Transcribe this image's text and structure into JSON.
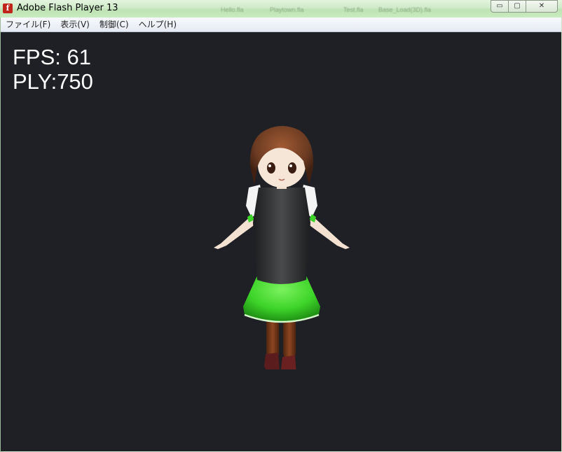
{
  "window": {
    "title": "Adobe Flash Player 13",
    "icon": "flash-icon",
    "icon_glyph": "f",
    "controls": {
      "minimize": "▭",
      "maximize": "▢",
      "close": "✕"
    },
    "background_tabs": [
      "Hello.fla",
      "Playtown.fla",
      "Test.fla",
      "Base_Load(3D).fla"
    ]
  },
  "menu": {
    "items": [
      "ファイル(F)",
      "表示(V)",
      "制御(C)",
      "ヘルプ(H)"
    ]
  },
  "stage": {
    "background_color": "#1e2025",
    "stats": {
      "fps": "FPS: 61",
      "ply": "PLY:750"
    }
  },
  "colors": {
    "skirt": "#3ed42a",
    "vest": "#2c2d2e",
    "hair": "#6b3b22",
    "stockings": "#7a3a18",
    "shoes": "#5a1c1c"
  }
}
